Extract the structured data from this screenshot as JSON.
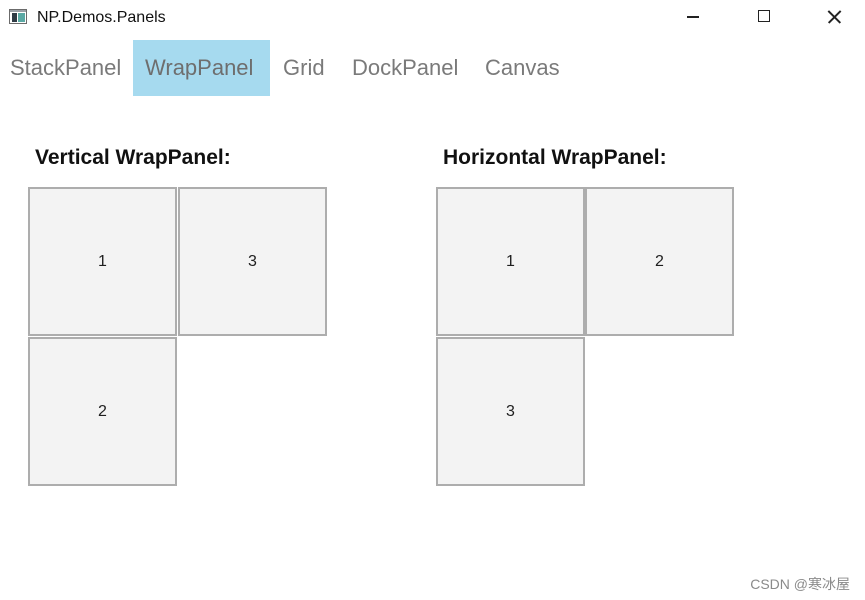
{
  "window": {
    "title": "NP.Demos.Panels"
  },
  "tabs": {
    "items": [
      {
        "label": "StackPanel"
      },
      {
        "label": "WrapPanel"
      },
      {
        "label": "Grid"
      },
      {
        "label": "DockPanel"
      },
      {
        "label": "Canvas"
      }
    ],
    "selected": "WrapPanel"
  },
  "vertical_panel": {
    "title": "Vertical WrapPanel:",
    "buttons": [
      "1",
      "2",
      "3"
    ]
  },
  "horizontal_panel": {
    "title": "Horizontal WrapPanel:",
    "buttons": [
      "1",
      "2",
      "3"
    ]
  },
  "watermark": "CSDN @寒冰屋",
  "colors": {
    "selected_tab_bg": "#a6daef",
    "tab_text": "#7a7a7a",
    "button_fill": "#f3f3f3",
    "button_border": "#adadad"
  },
  "icons": {
    "app": "app-icon",
    "minimize": "minimize-icon",
    "maximize": "maximize-icon",
    "close": "close-icon"
  }
}
